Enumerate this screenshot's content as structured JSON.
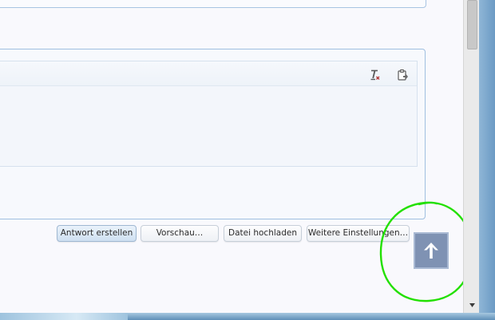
{
  "editor": {
    "toolbar": {
      "clear_format_icon": "remove-format-icon",
      "paste_icon": "paste-from-word-icon"
    }
  },
  "actions": {
    "create_reply": "Antwort erstellen",
    "preview": "Vorschau…",
    "upload_file": "Datei hochladen",
    "more_settings": "Weitere Einstellungen…"
  },
  "scroll_to_top": {
    "icon": "arrow-up-icon"
  },
  "colors": {
    "accent_border": "#9fbfe0",
    "primary_button": "#cfe0f1",
    "scroll_top_button": "#7f92b3",
    "highlight_ring": "#22e000"
  }
}
